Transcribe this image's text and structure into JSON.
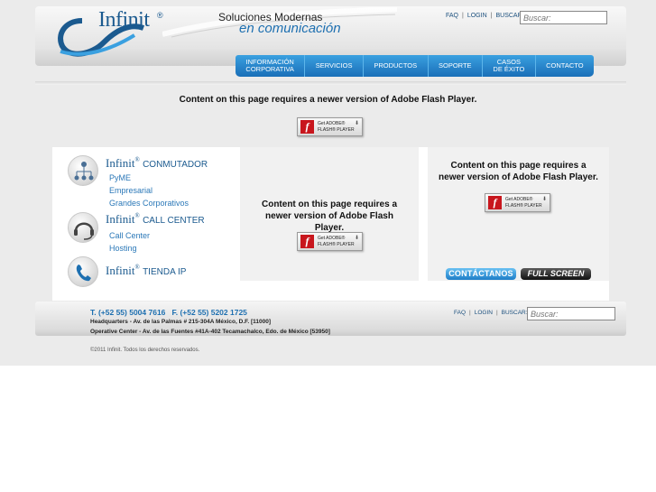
{
  "header": {
    "logo_text": "Infinit",
    "logo_reg": "®",
    "tagline_1": "Soluciones Modernas",
    "tagline_2": "en comunicación",
    "links": [
      "FAQ",
      "LOGIN",
      "BUSCAR:"
    ],
    "search_placeholder": "Buscar:"
  },
  "nav": {
    "items": [
      "INFORMACIÓN\nCORPORATIVA",
      "SERVICIOS",
      "PRODUCTOS",
      "SOPORTE",
      "CASOS\nDE ÉXITO",
      "CONTACTO"
    ]
  },
  "flash": {
    "message": "Content on this page requires a newer version of Adobe Flash Player.",
    "button_line_1": "Get ADOBE®",
    "button_line_2": "FLASH® PLAYER"
  },
  "services": [
    {
      "brand": "Infinit",
      "reg": "®",
      "name": "CONMUTADOR",
      "links": [
        "PyME",
        "Empresarial",
        "Grandes Corporativos"
      ]
    },
    {
      "brand": "Infinit",
      "reg": "®",
      "name": "CALL CENTER",
      "links": [
        "Call Center",
        "Hosting"
      ]
    },
    {
      "brand": "Infinit",
      "reg": "®",
      "name": "TIENDA IP",
      "links": []
    }
  ],
  "buttons": {
    "contact": "CONTÁCTANOS",
    "fullscreen": "FULL SCREEN"
  },
  "footer": {
    "phone": "T. (+52 55) 5004 7616   F. (+52 55) 5202 1725",
    "hq": "Headquarters - Av. de las Palmas # 215-304A México, D.F. [11000]",
    "operative": "Operative Center - Av. de las Fuentes #41A-402 Tecamachalco, Edo. de México [53950]",
    "links": [
      "FAQ",
      "LOGIN",
      "BUSCAR:"
    ],
    "search_placeholder": "Buscar:",
    "copyright": "©2011  Infinit.  Todos los derechos reservados."
  }
}
